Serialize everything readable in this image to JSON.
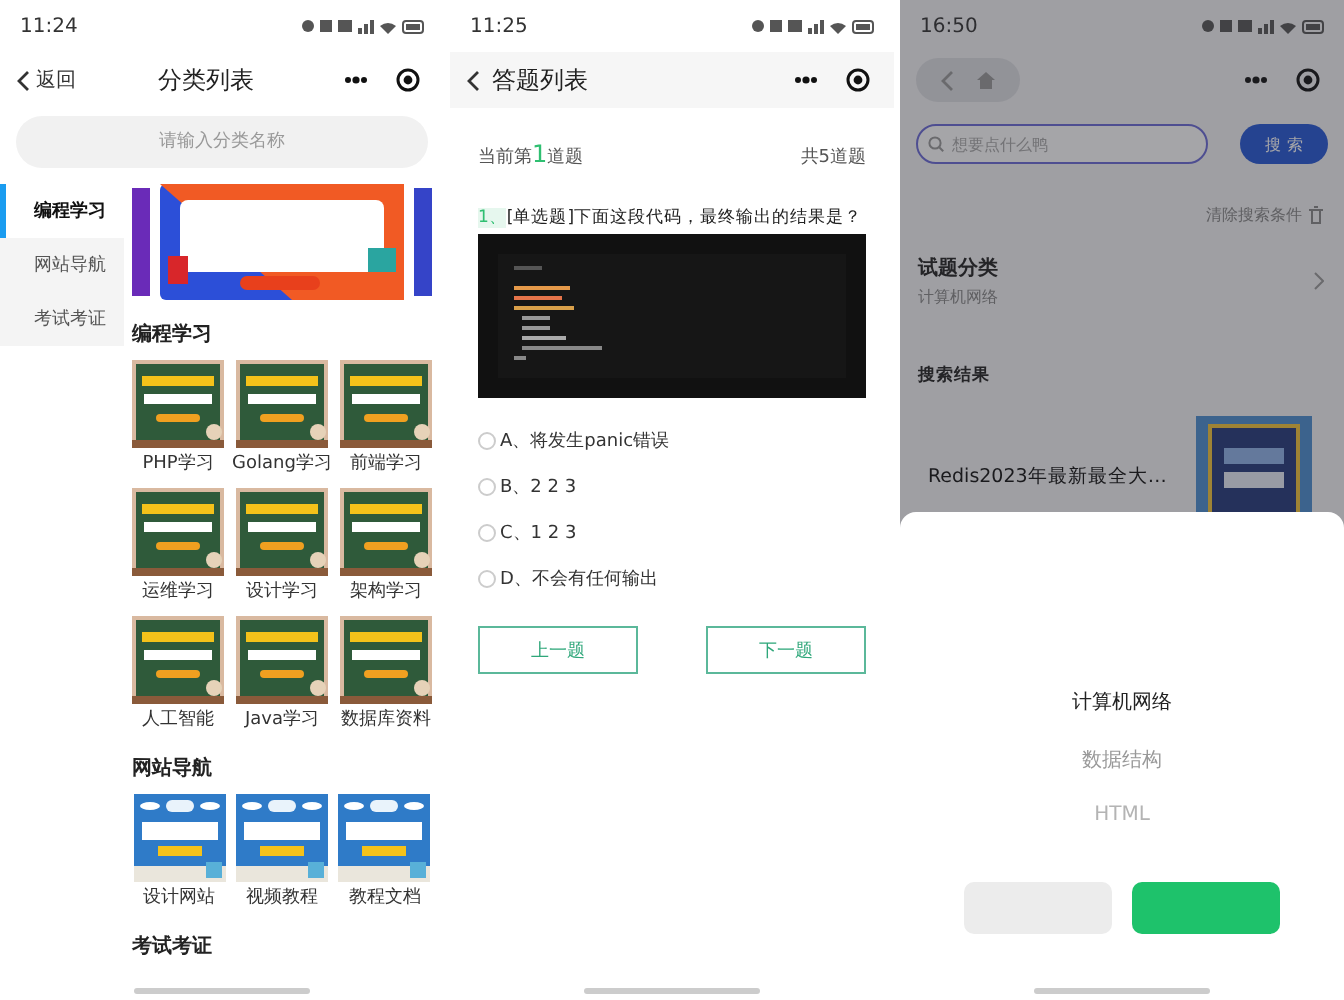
{
  "screens": [
    {
      "kind": "category",
      "status": {
        "time": "11:24"
      },
      "nav": {
        "back": "返回",
        "title": "分类列表"
      },
      "search": {
        "placeholder": "请输入分类名称"
      },
      "sidebar": [
        {
          "label": "编程学习",
          "selected": true
        },
        {
          "label": "网站导航",
          "selected": false
        },
        {
          "label": "考试考证",
          "selected": false
        }
      ],
      "sections": [
        {
          "title": "编程学习",
          "kind": "chalkboard",
          "items": [
            {
              "label": "PHP学习"
            },
            {
              "label": "Golang学习"
            },
            {
              "label": "前端学习"
            },
            {
              "label": "运维学习"
            },
            {
              "label": "设计学习"
            },
            {
              "label": "架构学习"
            },
            {
              "label": "人工智能"
            },
            {
              "label": "Java学习"
            },
            {
              "label": "数据库资料"
            }
          ]
        },
        {
          "title": "网站导航",
          "kind": "sky",
          "items": [
            {
              "label": "设计网站"
            },
            {
              "label": "视频教程"
            },
            {
              "label": "教程文档"
            }
          ]
        },
        {
          "title": "考试考证"
        }
      ]
    },
    {
      "kind": "quiz",
      "status": {
        "time": "11:25"
      },
      "nav": {
        "title": "答题列表"
      },
      "progress": {
        "before": "当前第",
        "current": "1",
        "after": "道题"
      },
      "total": "共5道题",
      "question": {
        "number": "1、",
        "text": "[单选题]下面这段代码，最终输出的结果是？"
      },
      "options": [
        {
          "label": "A、将发生panic错误",
          "selected": false
        },
        {
          "label": "B、2 2 3",
          "selected": false
        },
        {
          "label": "C、1 2 3",
          "selected": false
        },
        {
          "label": "D、不会有任何输出",
          "selected": false
        }
      ],
      "buttons": [
        {
          "label": "上一题"
        },
        {
          "label": "下一题"
        }
      ]
    },
    {
      "kind": "search",
      "status": {
        "time": "16:50"
      },
      "search": {
        "placeholder": "想要点什么鸭",
        "button": "搜 索"
      },
      "clear": "清除搜索条件",
      "filter": {
        "title": "试题分类",
        "value": "计算机网络"
      },
      "results_title": "搜索结果",
      "results": [
        {
          "title": "Redis2023年最新最全大…"
        }
      ],
      "picker": {
        "options": [
          {
            "label": "计算机网络",
            "selected": true
          },
          {
            "label": "数据结构",
            "selected": false
          },
          {
            "label": "HTML",
            "selected": false
          }
        ]
      }
    }
  ]
}
